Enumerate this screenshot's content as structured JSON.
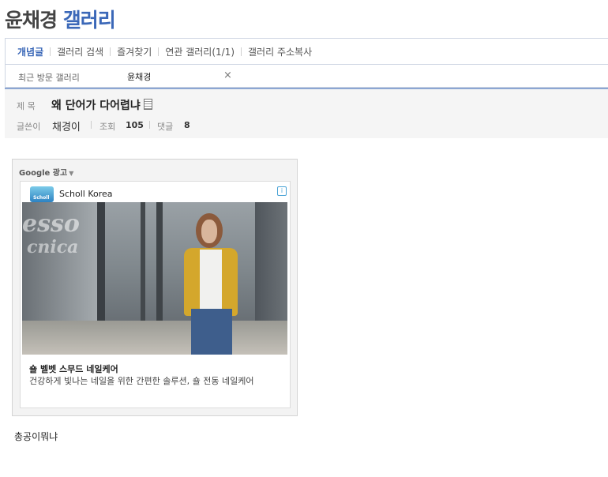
{
  "gallery": {
    "title_main": "윤채경",
    "title_accent": "갤러리"
  },
  "menu": {
    "items": [
      "개념글",
      "갤러리 검색",
      "즐겨찾기",
      "연관 갤러리(1/1)",
      "갤러리 주소복사"
    ]
  },
  "recent": {
    "label": "최근 방문 갤러리",
    "name": "윤채경",
    "close": "×"
  },
  "post": {
    "subject_label": "제 목",
    "subject": "왜 단어가 다어렵냐",
    "writer_label": "글쓴이",
    "writer": "채경이",
    "views_label": "조회",
    "views": "105",
    "comments_label": "댓글",
    "comments": "8",
    "body": "총공이뭐냐"
  },
  "ad": {
    "label": "Google 광고",
    "brand": "Scholl Korea",
    "logo_text": "Scholl",
    "info": "i",
    "image_text_1": "esso",
    "image_text_2": "cnica",
    "headline": "숄 벨벳 스무드 네일케어",
    "description": "건강하게 빛나는 네일을 위한 간편한 솔루션, 숄 전동 네일케어"
  },
  "colors": {
    "accent": "#3b68b8",
    "divider": "#8ca6d3"
  },
  "icons": [
    "chevron-down-icon",
    "info-icon",
    "close-icon",
    "document-icon"
  ]
}
